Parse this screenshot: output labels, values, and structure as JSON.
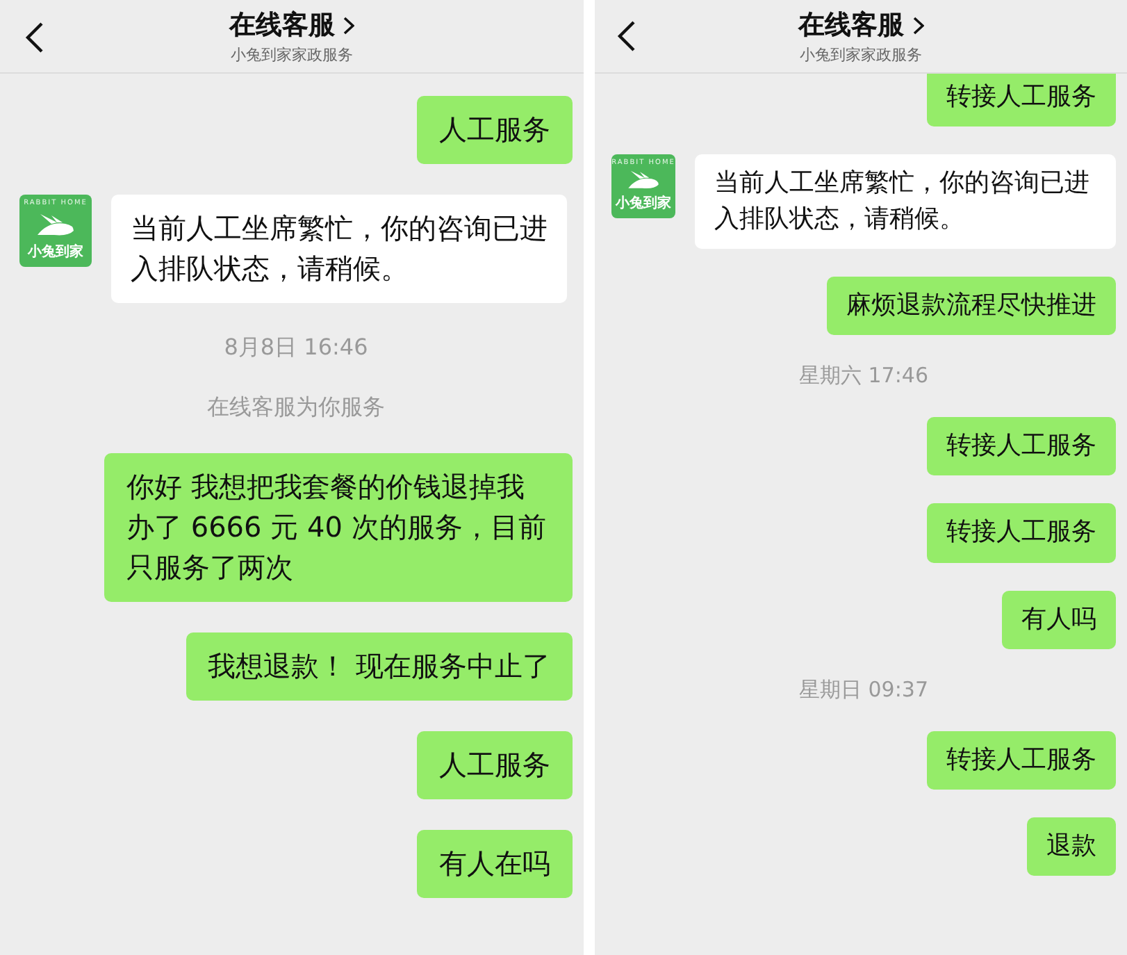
{
  "panels": [
    {
      "header": {
        "title": "在线客服",
        "subtitle": "小兔到家家政服务"
      },
      "messages": [
        {
          "kind": "sent",
          "text": "人工服务"
        },
        {
          "kind": "received",
          "text": "当前人工坐席繁忙，你的咨询已进入排队状态，请稍候。",
          "avatar": {
            "arc_text": "RABBIT HOME",
            "name": "小兔到家"
          }
        },
        {
          "kind": "time",
          "text": "8月8日 16:46"
        },
        {
          "kind": "notice",
          "text": "在线客服为你服务"
        },
        {
          "kind": "sent",
          "text": "你好 我想把我套餐的价钱退掉我办了 6666 元 40 次的服务，目前只服务了两次"
        },
        {
          "kind": "sent",
          "text": "我想退款！ 现在服务中止了"
        },
        {
          "kind": "sent",
          "text": "人工服务"
        },
        {
          "kind": "sent",
          "text": "有人在吗"
        }
      ]
    },
    {
      "header": {
        "title": "在线客服",
        "subtitle": "小兔到家家政服务"
      },
      "messages": [
        {
          "kind": "sent",
          "text": "转接人工服务"
        },
        {
          "kind": "received",
          "text": "当前人工坐席繁忙，你的咨询已进入排队状态，请稍候。",
          "avatar": {
            "arc_text": "RABBIT HOME",
            "name": "小兔到家"
          }
        },
        {
          "kind": "sent",
          "text": "麻烦退款流程尽快推进"
        },
        {
          "kind": "time",
          "text": "星期六 17:46"
        },
        {
          "kind": "sent",
          "text": "转接人工服务"
        },
        {
          "kind": "sent",
          "text": "转接人工服务"
        },
        {
          "kind": "sent",
          "text": "有人吗"
        },
        {
          "kind": "time",
          "text": "星期日 09:37"
        },
        {
          "kind": "sent",
          "text": "转接人工服务"
        },
        {
          "kind": "sent",
          "text": "退款"
        }
      ]
    }
  ]
}
